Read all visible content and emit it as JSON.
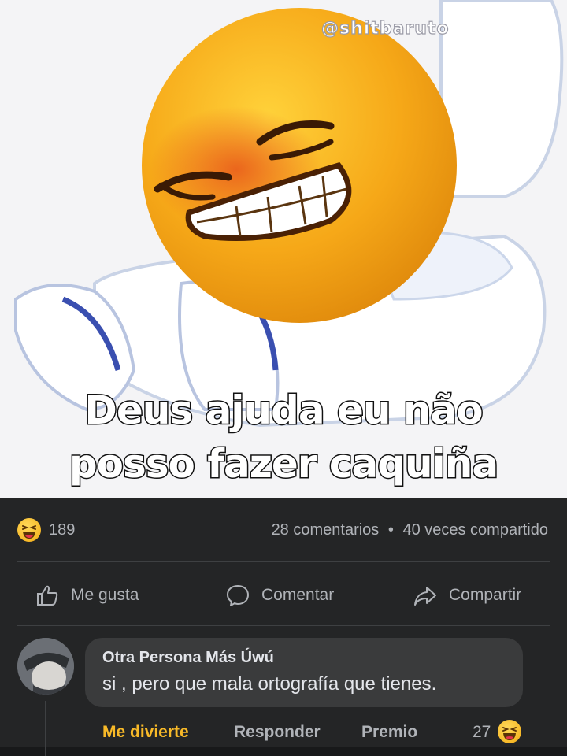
{
  "meme": {
    "watermark": "@shitbaruto",
    "caption_line1": "Deus ajuda eu não",
    "caption_line2": "posso fazer caquiña"
  },
  "post": {
    "reaction_icon": "laughing-emoji-icon",
    "reaction_count": "189",
    "comments_count": "28 comentarios",
    "separator": "•",
    "shares_count": "40 veces compartido"
  },
  "actions": {
    "like_label": "Me gusta",
    "comment_label": "Comentar",
    "share_label": "Compartir"
  },
  "comment": {
    "author": "Otra Persona Más Úwú",
    "text": "si , pero que mala ortografía que tienes.",
    "reaction_label": "Me divierte",
    "reply_label": "Responder",
    "award_label": "Premio",
    "reaction_count": "27"
  },
  "colors": {
    "background": "#18191a",
    "panel": "#242526",
    "bubble": "#3a3b3c",
    "text_primary": "#e4e6eb",
    "text_secondary": "#b0b3b8",
    "haha_accent": "#f7b928"
  }
}
